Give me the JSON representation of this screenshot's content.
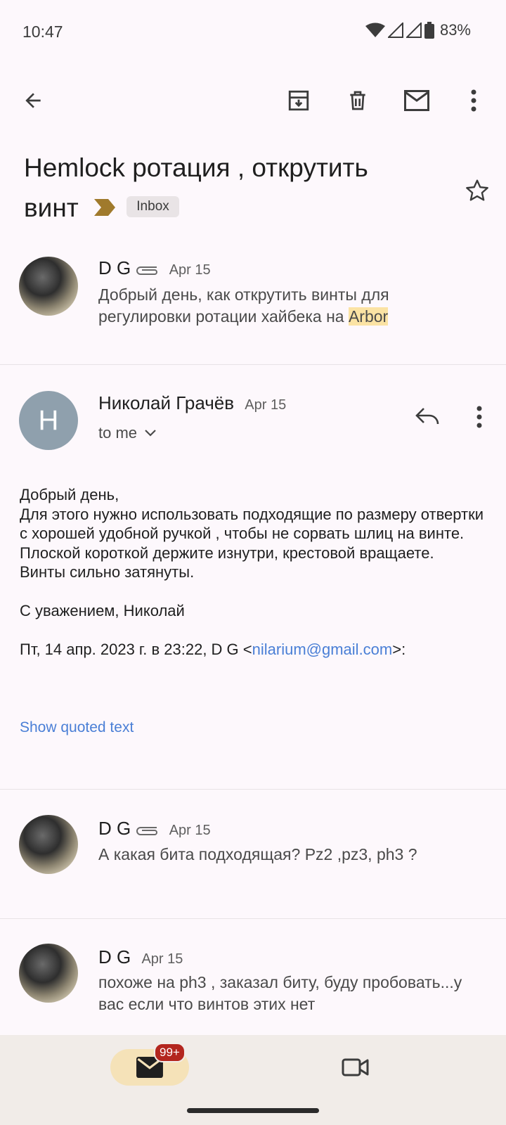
{
  "status": {
    "time": "10:47",
    "battery": "83%"
  },
  "subject": {
    "line1": "Hemlock ротация , открутить",
    "line2": "винт",
    "label": "Inbox"
  },
  "messages": [
    {
      "sender": "D G",
      "date": "Apr 15",
      "snippet_pre": "Добрый день, как открутить винты для регулировки ротации хайбека на ",
      "snippet_highlight": "Arbor"
    },
    {
      "sender": "Николай Грачёв",
      "date": "Apr 15",
      "initial": "Н",
      "recipient": "to me",
      "body": "Добрый день,\nДля этого нужно использовать подходящие по размеру отвертки с хорошей удобной ручкой , чтобы не сорвать шлиц на винте.\nПлоской короткой держите изнутри, крестовой вращаете.\nВинты сильно затянуты.\n\nС уважением, Николай\n\n",
      "quote_intro": "Пт, 14 апр. 2023 г. в 23:22, D G <",
      "quote_email": "nilarium@gmail.com",
      "quote_end": ">:",
      "show_quoted": "Show quoted text"
    },
    {
      "sender": "D G",
      "date": "Apr 15",
      "snippet": "А какая бита подходящая? Pz2 ,pz3, ph3 ?"
    },
    {
      "sender": "D G",
      "date": "Apr 15",
      "snippet": "похоже на ph3 , заказал биту, буду пробовать...у вас если что винтов этих нет"
    }
  ],
  "nav": {
    "mail_badge": "99+"
  },
  "colors": {
    "background": "#fdf8fc",
    "link": "#4a7fd6",
    "highlight": "#fbe3a4",
    "badge": "#b3261e",
    "important": "#a07a2c"
  },
  "icons": [
    "back-arrow-icon",
    "archive-icon",
    "delete-icon",
    "mail-icon",
    "more-vert-icon",
    "star-icon",
    "attachment-icon",
    "reply-icon",
    "chevron-down-icon",
    "videocam-icon",
    "wifi-icon",
    "signal-icon",
    "battery-icon"
  ]
}
